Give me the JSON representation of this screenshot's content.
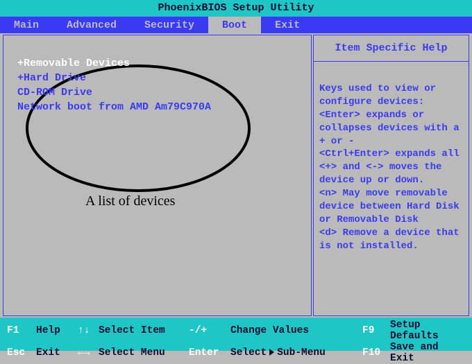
{
  "title": "PhoenixBIOS Setup Utility",
  "menu": {
    "items": [
      "Main",
      "Advanced",
      "Security",
      "Boot",
      "Exit"
    ],
    "active": "Boot"
  },
  "devices": [
    {
      "label": "+Removable Devices",
      "current": true
    },
    {
      "label": "+Hard Drive",
      "current": false
    },
    {
      "label": " CD-ROM Drive",
      "current": false
    },
    {
      "label": " Network boot from AMD Am79C970A",
      "current": false
    }
  ],
  "annotation": {
    "label": "A list of devices"
  },
  "help": {
    "header": "Item Specific Help",
    "body": "Keys used to view or configure devices:\n<Enter> expands or collapses devices with a + or -\n<Ctrl+Enter> expands all\n<+> and <-> moves the device up or down.\n<n> May move removable device between Hard Disk or Removable Disk\n<d> Remove a device that is not installed."
  },
  "footer": {
    "r1c1k": "F1",
    "r1c1l": "Help",
    "r1c2k": "↑↓",
    "r1c2l": "Select Item",
    "r1c3k": "-/+",
    "r1c3l": "Change Values",
    "r1c4k": "F9",
    "r1c4l": "Setup Defaults",
    "r2c1k": "Esc",
    "r2c1l": "Exit",
    "r2c2k": "←→",
    "r2c2l": "Select Menu",
    "r2c3k": "Enter",
    "r2c3l": "Select",
    "r2c3l2": "Sub-Menu",
    "r2c4k": "F10",
    "r2c4l": "Save and Exit"
  }
}
